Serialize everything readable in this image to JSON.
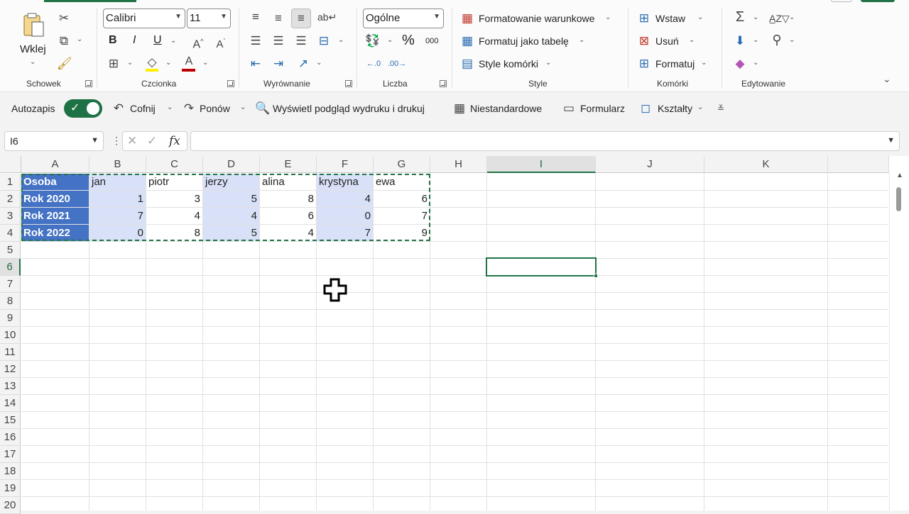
{
  "ribbon": {
    "clipboard": {
      "paste_label": "Wklej",
      "group_label": "Schowek"
    },
    "font": {
      "font_name": "Calibri",
      "font_size": "11",
      "bold": "B",
      "italic": "I",
      "underline": "U",
      "group_label": "Czcionka"
    },
    "alignment": {
      "group_label": "Wyrównanie"
    },
    "number": {
      "format": "Ogólne",
      "percent": "%",
      "thousands": "000",
      "group_label": "Liczba"
    },
    "styles": {
      "conditional": "Formatowanie warunkowe",
      "as_table": "Formatuj jako tabelę",
      "cell_styles": "Style komórki",
      "group_label": "Style"
    },
    "cells": {
      "insert": "Wstaw",
      "delete": "Usuń",
      "format": "Formatuj",
      "group_label": "Komórki"
    },
    "editing": {
      "group_label": "Edytowanie"
    }
  },
  "qat": {
    "autosave": "Autozapis",
    "undo": "Cofnij",
    "redo": "Ponów",
    "print_preview": "Wyświetl podgląd wydruku i drukuj",
    "custom": "Niestandardowe",
    "form": "Formularz",
    "shapes": "Kształty"
  },
  "formula_bar": {
    "name_box": "I6",
    "fx": "fx",
    "formula": ""
  },
  "sheet": {
    "columns": [
      "A",
      "B",
      "C",
      "D",
      "E",
      "F",
      "G",
      "H",
      "I",
      "J",
      "K"
    ],
    "rows": [
      "1",
      "2",
      "3",
      "4",
      "5",
      "6",
      "7",
      "8",
      "9",
      "10",
      "11",
      "12",
      "13",
      "14",
      "15",
      "16",
      "17",
      "18",
      "19",
      "20"
    ],
    "active_column": "I",
    "active_row": "6",
    "table": {
      "header": [
        "Osoba",
        "jan",
        "piotr",
        "jerzy",
        "alina",
        "krystyna",
        "ewa"
      ],
      "rows": [
        [
          "Rok 2020",
          "1",
          "3",
          "5",
          "8",
          "4",
          "6"
        ],
        [
          "Rok 2021",
          "7",
          "4",
          "4",
          "6",
          "0",
          "7"
        ],
        [
          "Rok 2022",
          "0",
          "8",
          "5",
          "4",
          "7",
          "9"
        ]
      ]
    }
  },
  "colors": {
    "accent": "#217346",
    "table_header": "#4472c4",
    "table_band": "#d9e1f8"
  }
}
